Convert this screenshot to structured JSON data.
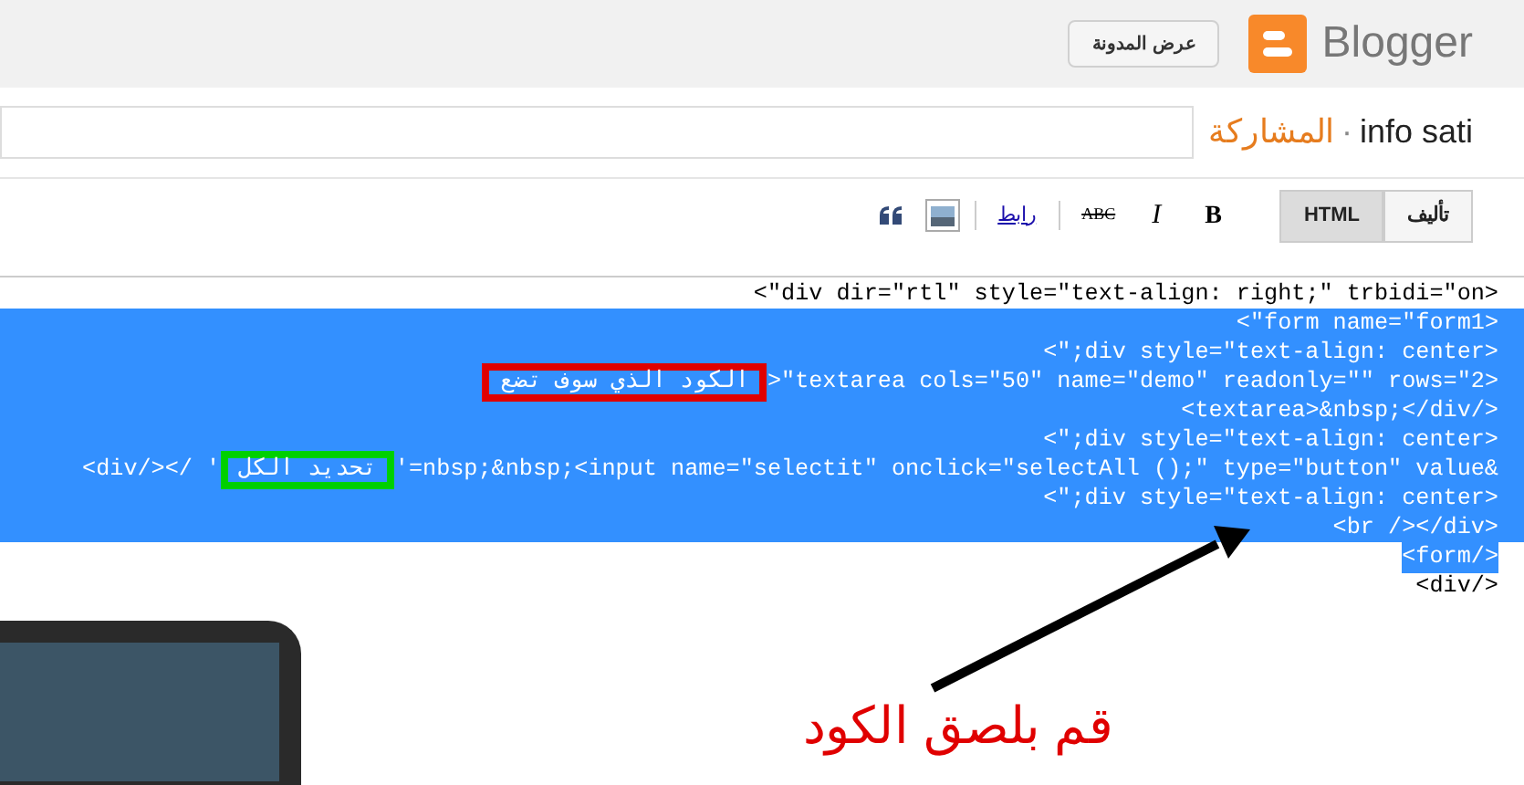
{
  "header": {
    "logo_text": "Blogger",
    "view_blog_button": "عرض المدونة"
  },
  "post": {
    "blog_name": "info sati",
    "separator": "·",
    "section": "المشاركة"
  },
  "toolbar": {
    "modes": [
      {
        "label": "تأليف",
        "selected": false
      },
      {
        "label": "HTML",
        "selected": true
      }
    ],
    "tools": [
      {
        "kind": "bold",
        "label": "B"
      },
      {
        "kind": "italic",
        "label": "I"
      },
      {
        "kind": "strike",
        "label": "ABC"
      },
      {
        "kind": "link",
        "label": "رابط"
      },
      {
        "kind": "image"
      },
      {
        "kind": "quote"
      }
    ]
  },
  "code_lines": [
    {
      "text": "<\"div dir=\"rtl\" style=\"text-align: right;\" trbidi=\"on>",
      "selected": false
    },
    {
      "text": "<\"form name=\"form1>",
      "selected": true
    },
    {
      "text": "<\";div style=\"text-align: center>",
      "selected": true
    },
    {
      "marked": {
        "text": "الكود الذي سوف تضع",
        "color": "#e00000"
      },
      "text": ">\"textarea cols=\"50\" name=\"demo\" readonly=\"\" rows=\"2>",
      "selected": true
    },
    {
      "text": "<textarea>&nbsp;</div/>",
      "selected": true
    },
    {
      "text": "<\";div style=\"text-align: center>",
      "selected": true
    },
    {
      "prefix": "<div/></ '",
      "marked": {
        "text": "تحديد الكل",
        "color": "#00d000"
      },
      "text": "'=nbsp;&nbsp;<input name=\"selectit\" onclick=\"selectAll ();\" type=\"button\" value&",
      "selected": true
    },
    {
      "text": "<\";div style=\"text-align: center>",
      "selected": true
    },
    {
      "text": "<br /></div>",
      "selected": true
    },
    {
      "text": "<form/>",
      "selected": true
    },
    {
      "text": "<div/>",
      "selected": false
    }
  ],
  "annotation": {
    "caption": "قم بلصق الكود"
  }
}
